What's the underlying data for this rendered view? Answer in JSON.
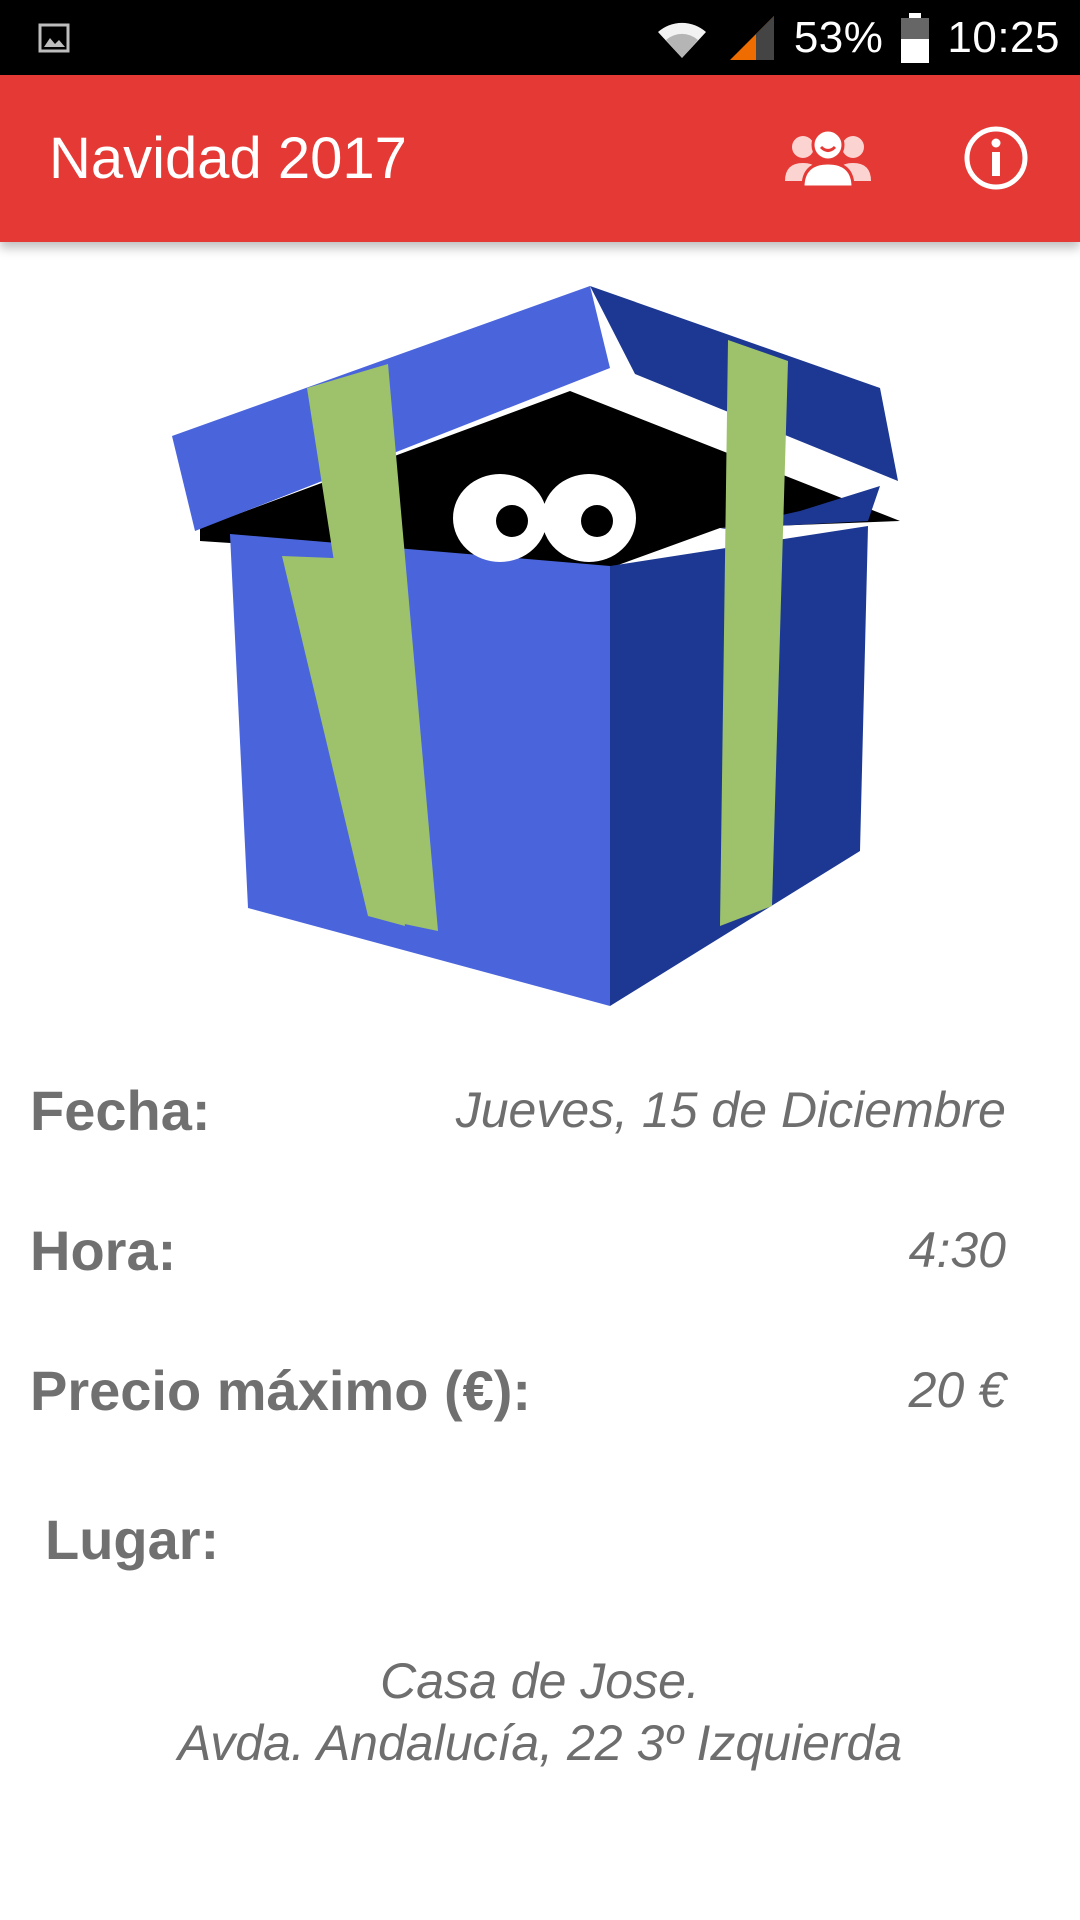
{
  "status_bar": {
    "icons": [
      "image-notification-icon",
      "wifi-icon",
      "cellular-signal-icon",
      "battery-icon"
    ],
    "battery": "53%",
    "time": "10:25"
  },
  "app_bar": {
    "title": "Navidad 2017",
    "background_color": "#e53935",
    "actions": [
      "group-icon",
      "info-icon"
    ]
  },
  "hero": {
    "image": "gift-box-with-eyes-illustration",
    "colors": {
      "box": "#4a65dc",
      "box_dark": "#1c3893",
      "ribbon": "#9ec26c"
    }
  },
  "details": {
    "fecha_label": "Fecha:",
    "fecha_value": "Jueves, 15 de Diciembre",
    "hora_label": "Hora:",
    "hora_value": "4:30",
    "precio_label": "Precio máximo (€):",
    "precio_value": "20 €",
    "lugar_label": "Lugar:",
    "lugar_line1": "Casa de Jose.",
    "lugar_line2": "Avda. Andalucía, 22 3º Izquierda"
  }
}
